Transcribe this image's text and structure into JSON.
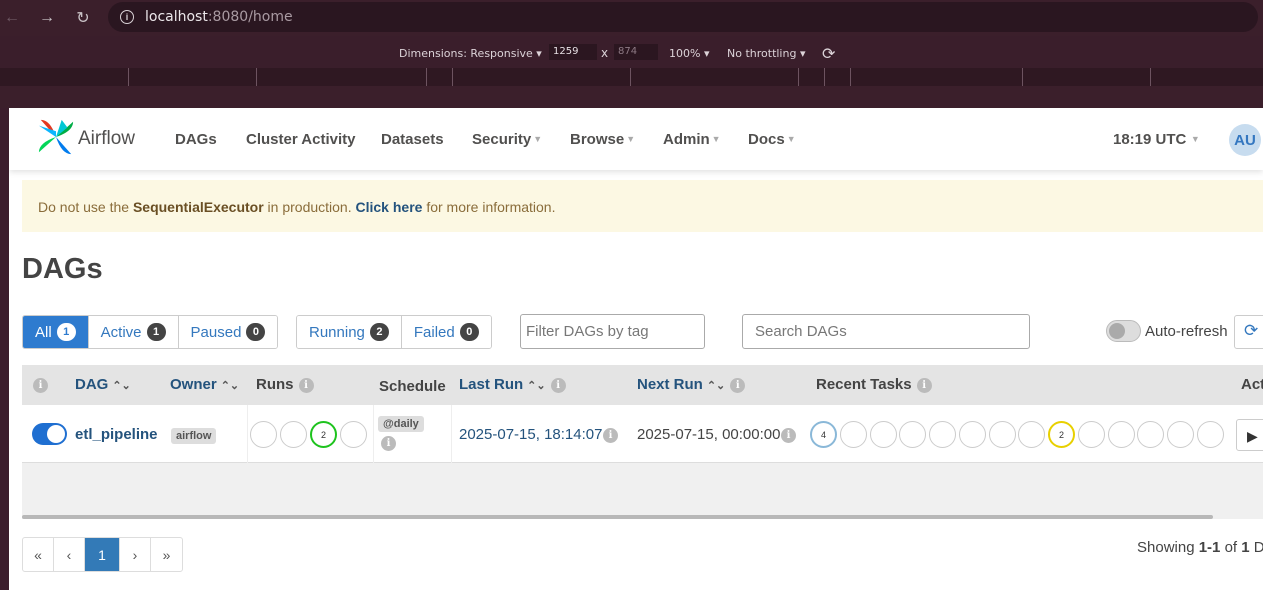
{
  "browser": {
    "back_icon": "arrow-left",
    "forward_icon": "arrow-right",
    "reload_icon": "reload",
    "url_host": "localhost",
    "url_rest": ":8080/home"
  },
  "devtools": {
    "dimensions_label": "Dimensions: Responsive",
    "width": "1259",
    "times": "x",
    "height": "874",
    "zoom": "100%",
    "throttling": "No throttling"
  },
  "navbar": {
    "brand": "Airflow",
    "items": [
      {
        "label": "DAGs",
        "caret": false
      },
      {
        "label": "Cluster Activity",
        "caret": false
      },
      {
        "label": "Datasets",
        "caret": false
      },
      {
        "label": "Security",
        "caret": true
      },
      {
        "label": "Browse",
        "caret": true
      },
      {
        "label": "Admin",
        "caret": true
      },
      {
        "label": "Docs",
        "caret": true
      }
    ],
    "clock": "18:19 UTC",
    "avatar": "AU"
  },
  "alert": {
    "prefix": "Do not use the ",
    "executor": "SequentialExecutor",
    "middle": " in production. ",
    "link": "Click here",
    "suffix": " for more information."
  },
  "page_title": "DAGs",
  "filters": {
    "status": [
      {
        "label": "All",
        "count": "1",
        "active": true
      },
      {
        "label": "Active",
        "count": "1",
        "active": false
      },
      {
        "label": "Paused",
        "count": "0",
        "active": false
      }
    ],
    "state": [
      {
        "label": "Running",
        "count": "2"
      },
      {
        "label": "Failed",
        "count": "0"
      }
    ],
    "tag_placeholder": "Filter DAGs by tag",
    "search_placeholder": "Search DAGs",
    "auto_refresh_label": "Auto-refresh",
    "auto_refresh_on": false
  },
  "table": {
    "headers": {
      "dag": "DAG",
      "owner": "Owner",
      "runs": "Runs",
      "schedule": "Schedule",
      "last_run": "Last Run",
      "next_run": "Next Run",
      "recent_tasks": "Recent Tasks",
      "actions": "Act"
    },
    "rows": [
      {
        "paused": false,
        "dag_id": "etl_pipeline",
        "owner": "airflow",
        "runs": [
          "",
          "",
          "2",
          ""
        ],
        "schedule": "@daily",
        "last_run": "2025-07-15, 18:14:07",
        "next_run": "2025-07-15, 00:00:00",
        "recent_tasks": [
          "4",
          "",
          "",
          "",
          "",
          "",
          "",
          "",
          "2",
          "",
          "",
          "",
          "",
          ""
        ]
      }
    ]
  },
  "pagination": {
    "first": "«",
    "prev": "‹",
    "current": "1",
    "next": "›",
    "last": "»"
  },
  "showing": {
    "prefix": "Showing ",
    "range": "1-1",
    "of": " of ",
    "total": "1",
    "suffix": " DA"
  },
  "colors": {
    "primary": "#2e7bcf",
    "success": "#1ec31e",
    "queued": "#8ab8d8",
    "upstream_failed": "#e8d000",
    "alert_bg": "#fcf8e3"
  }
}
